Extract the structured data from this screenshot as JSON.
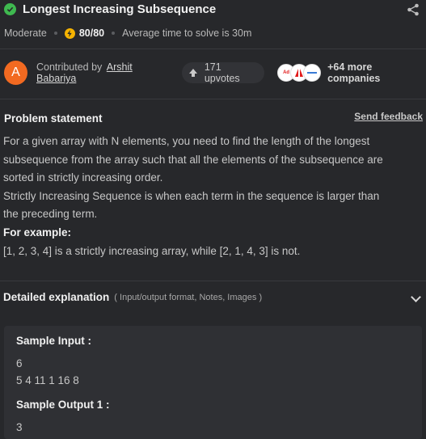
{
  "header": {
    "title": "Longest Increasing Subsequence",
    "difficulty": "Moderate",
    "score": "80/80",
    "avg_time": "Average time to solve is 30m"
  },
  "contributor": {
    "avatar_letter": "A",
    "prefix": "Contributed by",
    "name": "Arshit Babariya",
    "upvotes": "171 upvotes",
    "more_companies": "+64 more companies",
    "company_logos": [
      "Ad",
      "Adobe",
      "Morgan Stanley"
    ]
  },
  "problem": {
    "section_title": "Problem statement",
    "feedback_label": "Send feedback",
    "line1": "For a given array with N elements, you need to find the length of the longest",
    "line2": "subsequence from the array such that all the elements of the subsequence are",
    "line3": "sorted in strictly increasing order.",
    "line4": "Strictly Increasing Sequence is when each term in the sequence is larger than",
    "line5": "the preceding term.",
    "example_heading": "For example:",
    "example_text": "[1, 2, 3, 4] is a strictly increasing array, while [2, 1, 4, 3] is not."
  },
  "detailed": {
    "title": "Detailed explanation",
    "subtitle": "( Input/output format, Notes, Images )"
  },
  "sample": {
    "input_label": "Sample Input :",
    "input_line1": "6",
    "input_line2": "5 4 11 1 16 8",
    "output_label": "Sample Output 1 :",
    "output_value": "3"
  },
  "colors": {
    "background": "#27282b",
    "success": "#3fb950",
    "bolt": "#f5b301",
    "avatar": "#f26a21"
  }
}
